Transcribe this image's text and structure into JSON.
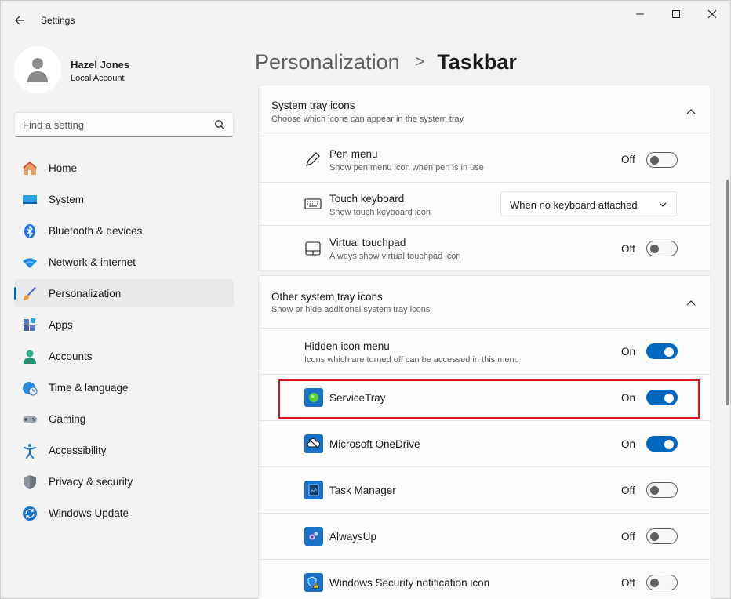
{
  "window": {
    "title": "Settings",
    "colors": {
      "accent": "#0067c0",
      "highlight": "#d9121b"
    }
  },
  "profile": {
    "name": "Hazel Jones",
    "account_type": "Local Account"
  },
  "search": {
    "placeholder": "Find a setting"
  },
  "sidebar": {
    "items": [
      {
        "label": "Home",
        "icon": "home-icon"
      },
      {
        "label": "System",
        "icon": "system-icon"
      },
      {
        "label": "Bluetooth & devices",
        "icon": "bluetooth-icon"
      },
      {
        "label": "Network & internet",
        "icon": "wifi-icon"
      },
      {
        "label": "Personalization",
        "icon": "brush-icon",
        "active": true
      },
      {
        "label": "Apps",
        "icon": "apps-icon"
      },
      {
        "label": "Accounts",
        "icon": "accounts-icon"
      },
      {
        "label": "Time & language",
        "icon": "clock-globe-icon"
      },
      {
        "label": "Gaming",
        "icon": "gamepad-icon"
      },
      {
        "label": "Accessibility",
        "icon": "accessibility-icon"
      },
      {
        "label": "Privacy & security",
        "icon": "shield-icon"
      },
      {
        "label": "Windows Update",
        "icon": "update-icon"
      }
    ]
  },
  "breadcrumb": {
    "parent": "Personalization",
    "separator": ">",
    "current": "Taskbar"
  },
  "system_tray": {
    "title": "System tray icons",
    "subtitle": "Choose which icons can appear in the system tray",
    "items": {
      "pen": {
        "title": "Pen menu",
        "subtitle": "Show pen menu icon when pen is in use",
        "state": "Off"
      },
      "touch_keyboard": {
        "title": "Touch keyboard",
        "subtitle": "Show touch keyboard icon",
        "value": "When no keyboard attached"
      },
      "touchpad": {
        "title": "Virtual touchpad",
        "subtitle": "Always show virtual touchpad icon",
        "state": "Off"
      }
    }
  },
  "other_tray": {
    "title": "Other system tray icons",
    "subtitle": "Show or hide additional system tray icons",
    "hidden_menu": {
      "title": "Hidden icon menu",
      "subtitle": "Icons which are turned off can be accessed in this menu",
      "state": "On"
    },
    "apps": {
      "servicetray": {
        "title": "ServiceTray",
        "state": "On"
      },
      "onedrive": {
        "title": "Microsoft OneDrive",
        "state": "On"
      },
      "taskmanager": {
        "title": "Task Manager",
        "state": "Off"
      },
      "alwaysup": {
        "title": "AlwaysUp",
        "state": "Off"
      },
      "security": {
        "title": "Windows Security notification icon",
        "state": "Off"
      }
    }
  }
}
